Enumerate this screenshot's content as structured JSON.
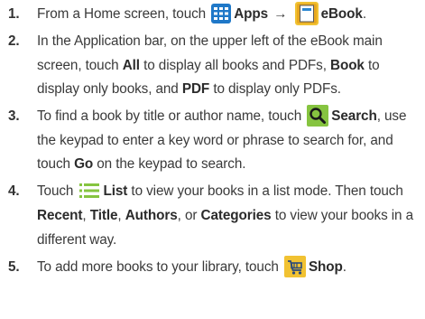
{
  "steps": [
    {
      "num": "1.",
      "parts": [
        {
          "t": "text",
          "v": "From a Home screen, touch "
        },
        {
          "t": "icon",
          "icon": "apps-icon"
        },
        {
          "t": "bold",
          "v": "Apps"
        },
        {
          "t": "arrow",
          "v": " → "
        },
        {
          "t": "icon",
          "icon": "ebook-icon"
        },
        {
          "t": "bold",
          "v": "eBook"
        },
        {
          "t": "text",
          "v": "."
        }
      ]
    },
    {
      "num": "2.",
      "parts": [
        {
          "t": "text",
          "v": "In the Application bar, on the upper left of the eBook main screen, touch "
        },
        {
          "t": "bold",
          "v": "All"
        },
        {
          "t": "text",
          "v": " to display all books and PDFs, "
        },
        {
          "t": "bold",
          "v": "Book"
        },
        {
          "t": "text",
          "v": " to display only books, and "
        },
        {
          "t": "bold",
          "v": "PDF"
        },
        {
          "t": "text",
          "v": " to display only PDFs."
        }
      ]
    },
    {
      "num": "3.",
      "parts": [
        {
          "t": "text",
          "v": "To find a book by title or author name, touch "
        },
        {
          "t": "icon",
          "icon": "search-icon"
        },
        {
          "t": "bold",
          "v": "Search"
        },
        {
          "t": "text",
          "v": ", use the keypad to enter a key word or phrase to search for, and touch "
        },
        {
          "t": "bold",
          "v": "Go"
        },
        {
          "t": "text",
          "v": " on the keypad to search."
        }
      ]
    },
    {
      "num": "4.",
      "parts": [
        {
          "t": "text",
          "v": "Touch "
        },
        {
          "t": "icon",
          "icon": "list-icon"
        },
        {
          "t": "bold",
          "v": "List"
        },
        {
          "t": "text",
          "v": " to view your books in a list mode. Then touch "
        },
        {
          "t": "bold",
          "v": "Recent"
        },
        {
          "t": "text",
          "v": ", "
        },
        {
          "t": "bold",
          "v": "Title"
        },
        {
          "t": "text",
          "v": ", "
        },
        {
          "t": "bold",
          "v": "Authors"
        },
        {
          "t": "text",
          "v": ", or "
        },
        {
          "t": "bold",
          "v": "Categories"
        },
        {
          "t": "text",
          "v": " to view your books in a different way."
        }
      ]
    },
    {
      "num": "5.",
      "parts": [
        {
          "t": "text",
          "v": "To add more books to your library, touch "
        },
        {
          "t": "icon",
          "icon": "shop-icon"
        },
        {
          "t": "bold",
          "v": "Shop"
        },
        {
          "t": "text",
          "v": "."
        }
      ]
    }
  ]
}
